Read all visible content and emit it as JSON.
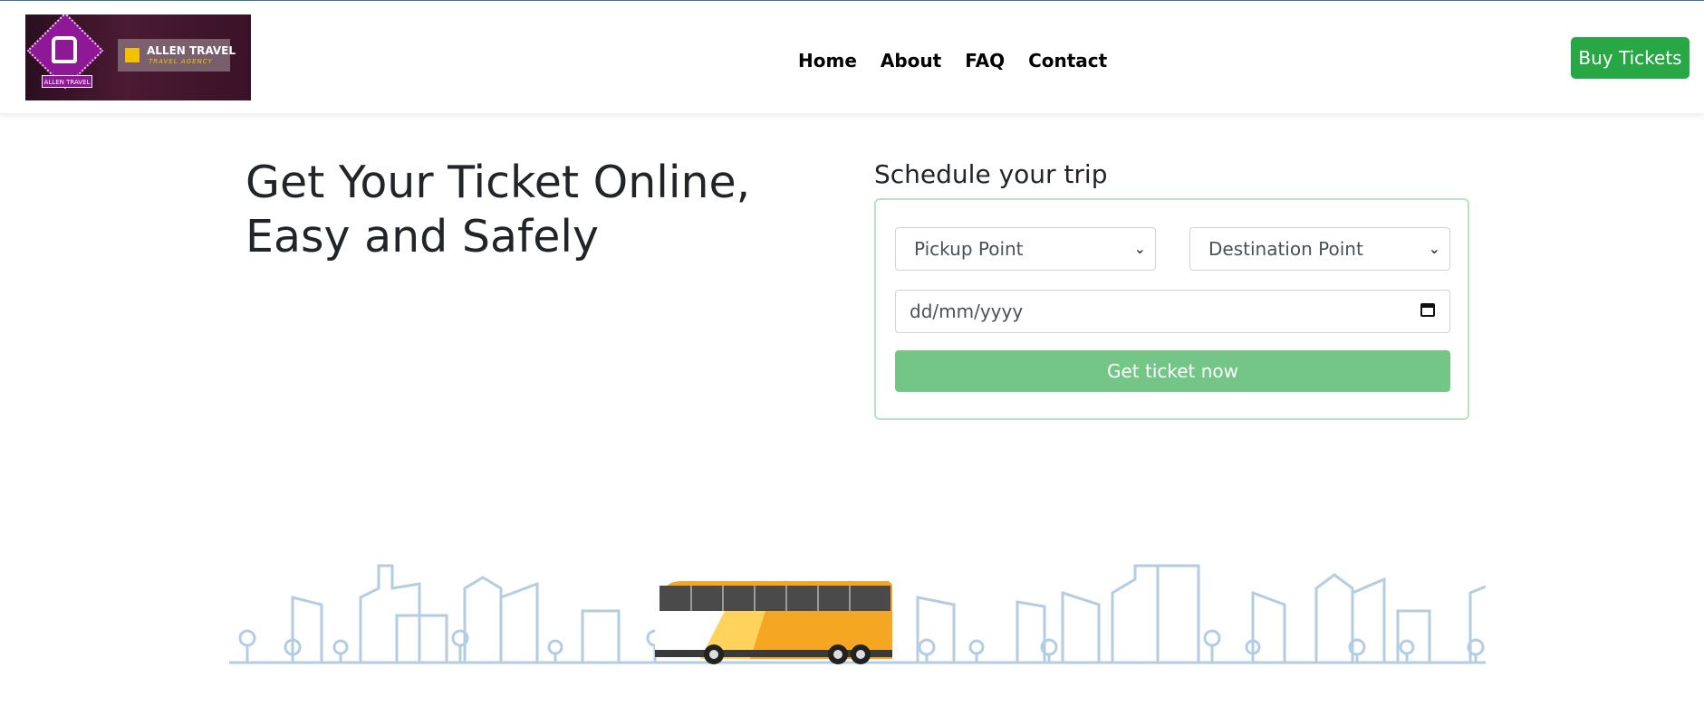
{
  "brand": {
    "logo_title": "ALLEN TRAVEL",
    "logo_subtitle": "TRAVEL AGENCY",
    "logo_badge": "ALLEN TRAVEL"
  },
  "nav": {
    "items": [
      "Home",
      "About",
      "FAQ",
      "Contact"
    ]
  },
  "header": {
    "buy_label": "Buy Tickets"
  },
  "hero": {
    "line1": "Get Your Ticket Online,",
    "line2": "Easy and Safely"
  },
  "form": {
    "heading": "Schedule your trip",
    "pickup_placeholder": "Pickup Point",
    "destination_placeholder": "Destination Point",
    "date_placeholder": "dd/mm/yyyy",
    "submit_label": "Get ticket now"
  },
  "colors": {
    "accent": "#28a745",
    "submit_disabled": "#74c687",
    "city_line": "#b3cde3",
    "bus_orange": "#f5a623"
  }
}
